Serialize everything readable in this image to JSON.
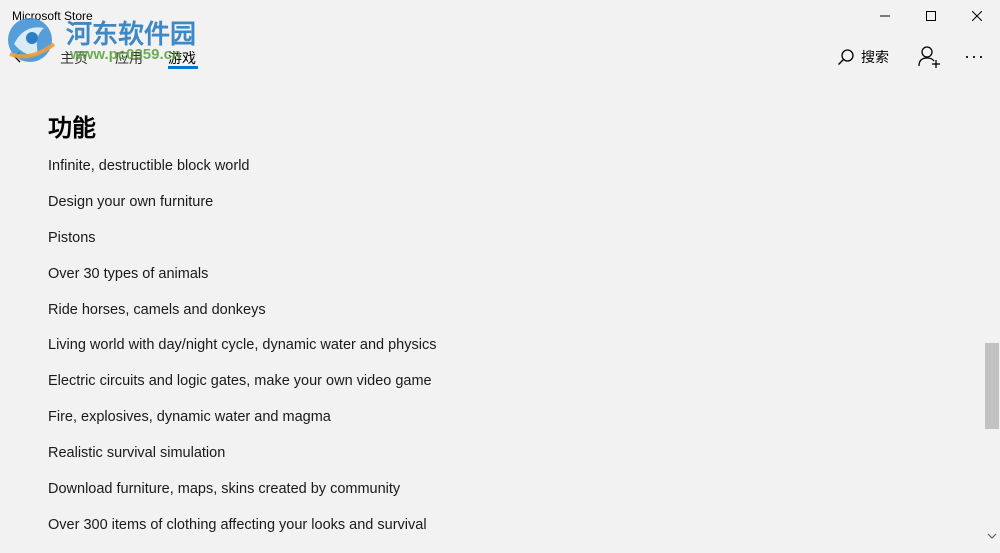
{
  "window": {
    "title": "Microsoft Store"
  },
  "nav": {
    "tabs": [
      {
        "label": "主页",
        "active": false
      },
      {
        "label": "应用",
        "active": false
      },
      {
        "label": "游戏",
        "active": true
      }
    ],
    "search_label": "搜索",
    "more_label": "···",
    "accent_color": "#0078d4"
  },
  "watermark": {
    "site_name": "河东软件园",
    "url": "www.pc0359.cn"
  },
  "features": {
    "title": "功能",
    "items": [
      "Infinite, destructible block world",
      "Design your own furniture",
      "Pistons",
      "Over 30 types of animals",
      "Ride horses, camels and donkeys",
      "Living world with day/night cycle, dynamic water and physics",
      "Electric circuits and logic gates, make your own video game",
      "Fire, explosives, dynamic water and magma",
      "Realistic survival simulation",
      "Download furniture, maps, skins created by community",
      "Over 300 items of clothing affecting your looks and survival"
    ]
  },
  "scrollbar": {
    "position_fraction": 0.72
  }
}
